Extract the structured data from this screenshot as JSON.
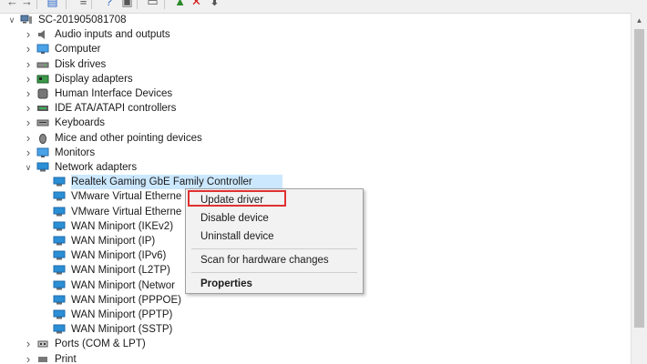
{
  "toolbar": {
    "buttons": [
      {
        "icon": "back-arrow-icon",
        "glyph": "←"
      },
      {
        "icon": "forward-arrow-icon",
        "glyph": "→"
      },
      {
        "icon": "properties-icon",
        "glyph": "▤"
      },
      {
        "icon": "list-icon",
        "glyph": "≡"
      },
      {
        "icon": "help-icon",
        "glyph": "?"
      },
      {
        "icon": "view-icon",
        "glyph": "▣"
      },
      {
        "icon": "monitor-icon",
        "glyph": "▭"
      },
      {
        "icon": "update-driver-icon",
        "glyph": "▲"
      },
      {
        "icon": "uninstall-icon",
        "glyph": "✕"
      },
      {
        "icon": "scan-icon",
        "glyph": "⬇"
      }
    ]
  },
  "tree": {
    "root": {
      "label": "SC-201905081708",
      "icon": "computer-root-icon",
      "expanded": true
    },
    "categories": [
      {
        "label": "Audio inputs and outputs",
        "icon": "speaker-icon"
      },
      {
        "label": "Computer",
        "icon": "computer-icon"
      },
      {
        "label": "Disk drives",
        "icon": "disk-drive-icon"
      },
      {
        "label": "Display adapters",
        "icon": "display-adapter-icon"
      },
      {
        "label": "Human Interface Devices",
        "icon": "hid-icon"
      },
      {
        "label": "IDE ATA/ATAPI controllers",
        "icon": "ide-controller-icon"
      },
      {
        "label": "Keyboards",
        "icon": "keyboard-icon"
      },
      {
        "label": "Mice and other pointing devices",
        "icon": "mouse-icon"
      },
      {
        "label": "Monitors",
        "icon": "monitor-icon"
      },
      {
        "label": "Network adapters",
        "icon": "network-adapter-icon",
        "expanded": true
      }
    ],
    "network_children": [
      {
        "label": "Realtek Gaming GbE Family Controller",
        "selected": true
      },
      {
        "label": "VMware Virtual Etherne"
      },
      {
        "label": "VMware Virtual Etherne"
      },
      {
        "label": "WAN Miniport (IKEv2)"
      },
      {
        "label": "WAN Miniport (IP)"
      },
      {
        "label": "WAN Miniport (IPv6)"
      },
      {
        "label": "WAN Miniport (L2TP)"
      },
      {
        "label": "WAN Miniport (Networ"
      },
      {
        "label": "WAN Miniport (PPPOE)"
      },
      {
        "label": "WAN Miniport (PPTP)"
      },
      {
        "label": "WAN Miniport (SSTP)"
      }
    ],
    "after": [
      {
        "label": "Ports (COM & LPT)",
        "icon": "port-icon"
      },
      {
        "label": "Print",
        "icon": "printer-icon"
      }
    ]
  },
  "context_menu": {
    "items": [
      {
        "label": "Update driver",
        "highlighted": true
      },
      {
        "label": "Disable device"
      },
      {
        "label": "Uninstall device"
      },
      {
        "label": "Scan for hardware changes"
      },
      {
        "label": "Properties",
        "bold": true
      }
    ]
  },
  "colors": {
    "selection": "#cce8ff",
    "highlight_border": "#e03030",
    "network_icon": "#2b8fd6"
  }
}
